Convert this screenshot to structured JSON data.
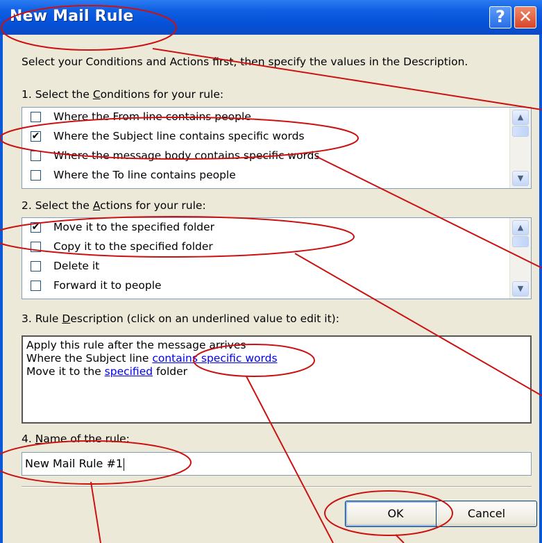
{
  "window": {
    "title": "New Mail Rule",
    "help_label": "?",
    "close_label": "✕"
  },
  "instructions": "Select your Conditions and Actions first, then specify the values in the Description.",
  "conditions": {
    "label_pre": "1. Select the ",
    "label_accel": "C",
    "label_post": "onditions for your rule:",
    "items": [
      {
        "label": "Where the From line contains people",
        "checked": false
      },
      {
        "label": "Where the Subject line contains specific words",
        "checked": true
      },
      {
        "label": "Where the message body contains specific words",
        "checked": false
      },
      {
        "label": "Where the To line contains people",
        "checked": false
      }
    ]
  },
  "actions": {
    "label_pre": "2. Select the ",
    "label_accel": "A",
    "label_post": "ctions for your rule:",
    "items": [
      {
        "label": "Move it to the specified folder",
        "checked": true
      },
      {
        "label": "Copy it to the specified folder",
        "checked": false
      },
      {
        "label": "Delete it",
        "checked": false
      },
      {
        "label": "Forward it to people",
        "checked": false
      }
    ]
  },
  "description": {
    "label_pre": "3. Rule ",
    "label_accel": "D",
    "label_post": "escription (click on an underlined value to edit it):",
    "line1": "Apply this rule after the message arrives",
    "line2_pre": "Where the Subject line ",
    "line2_link": "contains specific words",
    "line3_pre": "Move it to the ",
    "line3_link": "specified",
    "line3_post": " folder"
  },
  "name": {
    "label_pre": "4. ",
    "label_accel": "N",
    "label_post": "ame of the rule:",
    "value": "New Mail Rule #1"
  },
  "buttons": {
    "ok": "OK",
    "cancel": "Cancel"
  },
  "icons": {
    "checkmark": "✔",
    "scroll_up": "▲",
    "scroll_down": "▼"
  },
  "colors": {
    "titlebar": "#0550d6",
    "dialog_face": "#ece9d8",
    "link": "#0000ee",
    "annotation": "#cc1111"
  }
}
